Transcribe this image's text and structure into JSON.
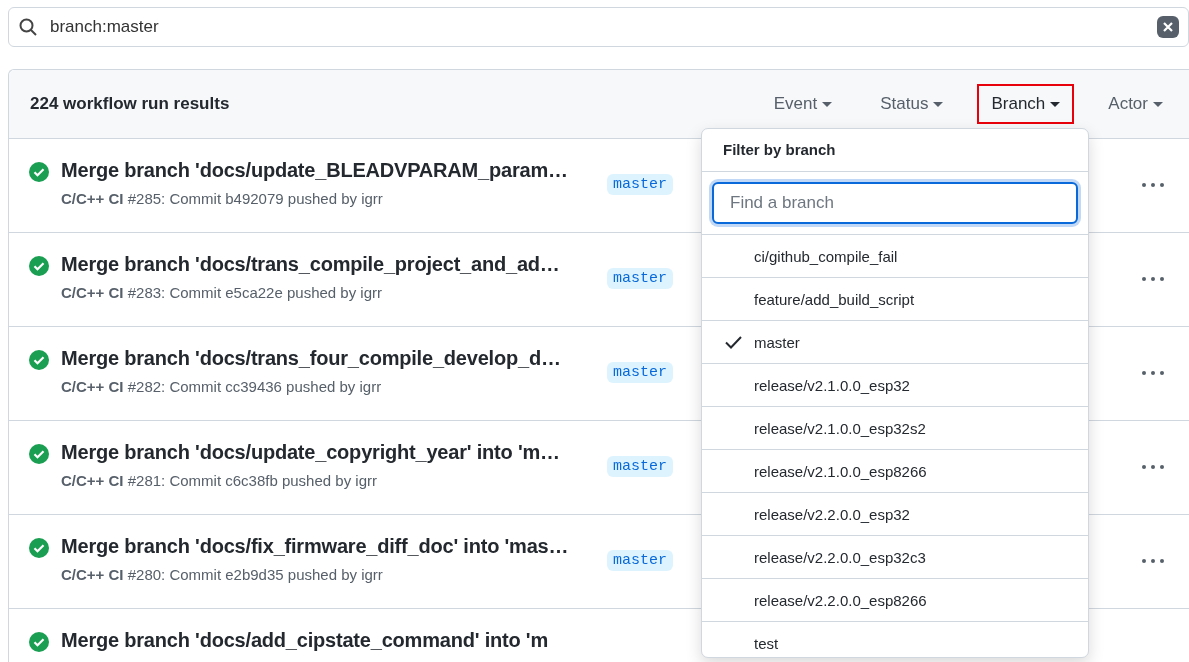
{
  "search": {
    "value": "branch:master"
  },
  "results": {
    "count_label": "224 workflow run results"
  },
  "filters": [
    {
      "label": "Event",
      "selected": false
    },
    {
      "label": "Status",
      "selected": false
    },
    {
      "label": "Branch",
      "selected": true
    },
    {
      "label": "Actor",
      "selected": false
    }
  ],
  "runs": [
    {
      "passed": true,
      "title": "Merge branch 'docs/update_BLEADVPARAM_param…",
      "workflow": "C/C++ CI",
      "number": "#285",
      "detail": ": Commit b492079 pushed by igrr",
      "branch": "master"
    },
    {
      "passed": true,
      "title": "Merge branch 'docs/trans_compile_project_and_ad…",
      "workflow": "C/C++ CI",
      "number": "#283",
      "detail": ": Commit e5ca22e pushed by igrr",
      "branch": "master"
    },
    {
      "passed": true,
      "title": "Merge branch 'docs/trans_four_compile_develop_d…",
      "workflow": "C/C++ CI",
      "number": "#282",
      "detail": ": Commit cc39436 pushed by igrr",
      "branch": "master"
    },
    {
      "passed": true,
      "title": "Merge branch 'docs/update_copyright_year' into 'm…",
      "workflow": "C/C++ CI",
      "number": "#281",
      "detail": ": Commit c6c38fb pushed by igrr",
      "branch": "master"
    },
    {
      "passed": true,
      "title": "Merge branch 'docs/fix_firmware_diff_doc' into 'mas…",
      "workflow": "C/C++ CI",
      "number": "#280",
      "detail": ": Commit e2b9d35 pushed by igrr",
      "branch": "master"
    },
    {
      "passed": true,
      "title": "Merge branch 'docs/add_cipstate_command' into 'm"
    }
  ],
  "branch_menu": {
    "title": "Filter by branch",
    "placeholder": "Find a branch",
    "items": [
      {
        "label": "ci/github_compile_fail",
        "selected": false
      },
      {
        "label": "feature/add_build_script",
        "selected": false
      },
      {
        "label": "master",
        "selected": true
      },
      {
        "label": "release/v2.1.0.0_esp32",
        "selected": false
      },
      {
        "label": "release/v2.1.0.0_esp32s2",
        "selected": false
      },
      {
        "label": "release/v2.1.0.0_esp8266",
        "selected": false
      },
      {
        "label": "release/v2.2.0.0_esp32",
        "selected": false
      },
      {
        "label": "release/v2.2.0.0_esp32c3",
        "selected": false
      },
      {
        "label": "release/v2.2.0.0_esp8266",
        "selected": false
      },
      {
        "label": "test",
        "selected": false
      }
    ]
  }
}
